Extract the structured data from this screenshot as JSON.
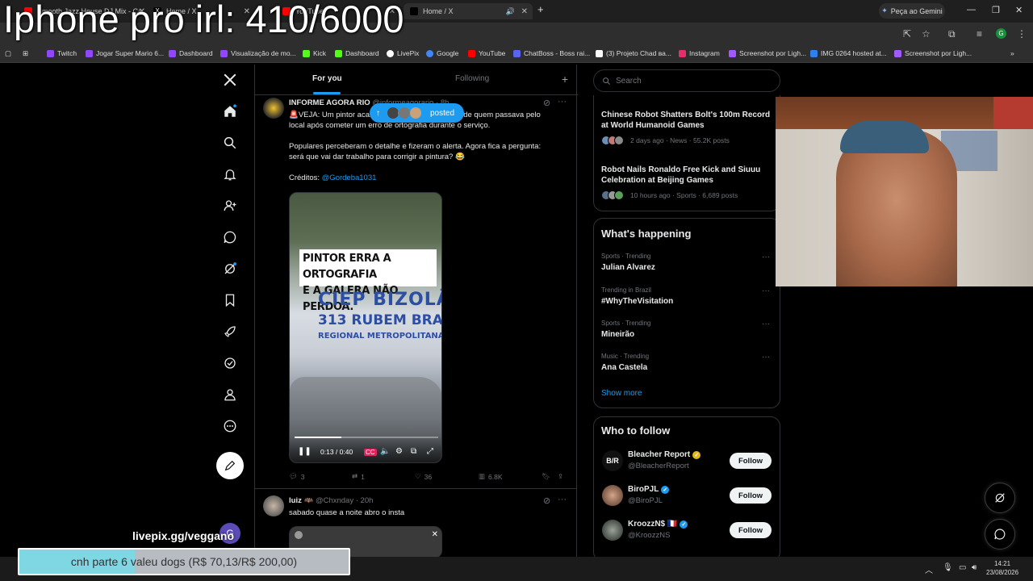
{
  "overlay": {
    "title": "Iphone pro irl: 410/6000",
    "livepix": "livepix.gg/veggano"
  },
  "browser": {
    "tabs": [
      {
        "label": "Smooth Jazz House DJ Mix - Ca",
        "color": "#ff0000"
      },
      {
        "label": "Home / X",
        "color": "#ffffff"
      },
      {
        "label": "YouTube",
        "color": "#ff0000"
      },
      {
        "label": "Home / X",
        "color": "#ffffff"
      }
    ],
    "gemini_label": "Peça ao Gemini",
    "address": "x.com/home",
    "bookmarks": [
      {
        "label": "Twitch",
        "color": "#9146ff"
      },
      {
        "label": "Jogar Super Mario 6...",
        "color": "#9146ff"
      },
      {
        "label": "Dashboard",
        "color": "#9146ff"
      },
      {
        "label": "Visualização de mo...",
        "color": "#9146ff"
      },
      {
        "label": "Kick",
        "color": "#53fc18"
      },
      {
        "label": "Dashboard",
        "color": "#53fc18"
      },
      {
        "label": "LivePix",
        "color": "#ffffff"
      },
      {
        "label": "Google",
        "color": "#4285f4"
      },
      {
        "label": "YouTube",
        "color": "#ff0000"
      },
      {
        "label": "ChatBoss - Boss rai...",
        "color": "#5865f2"
      },
      {
        "label": "(3) Projeto Chad ва...",
        "color": "#ffffff"
      },
      {
        "label": "Instagram",
        "color": "#e1306c"
      },
      {
        "label": "Screenshot por Ligh...",
        "color": "#a259ff"
      },
      {
        "label": "IMG 0264 hosted at...",
        "color": "#2f80ed"
      },
      {
        "label": "Screenshot por Ligh...",
        "color": "#a259ff"
      }
    ]
  },
  "timeline": {
    "tabs": [
      "For you",
      "Following"
    ],
    "active_tab": "For you",
    "posted_pill": "posted",
    "tweet1": {
      "name": "INFORME AGORA RIO",
      "handle": "@informeagorario · 8h",
      "text_line1": "🚨VEJA: Um pintor acabou virando alvo de piadas de quem passava pelo",
      "text_line2": "local após cometer um erro de ortografia durante o serviço.",
      "text_para2_line1": "Populares perceberam o detalhe e fizeram o alerta. Agora fica a pergunta:",
      "text_para2_line2": "será que vai dar trabalho para corrigir a pintura? 😂",
      "credits_label": "Créditos:",
      "credits_handle": "@Gordeba1031",
      "video": {
        "caption_line1": "PINTOR ERRA A ORTOGRAFIA",
        "caption_line2": "E A GALERA NÃO PERDOA.",
        "wall_line1": "CIEP BIZOLÃO",
        "wall_line2": "313 RUBEM BRAG",
        "wall_line3": "REGIONAL METROPOLITANA",
        "time": "0:13 / 0:40",
        "progress": 0.325
      },
      "replies": "3",
      "reposts": "1",
      "likes": "36",
      "views": "6.8K"
    },
    "tweet2": {
      "name": "luiz 🦇",
      "handle": "@Chxnday · 20h",
      "text": "sabado quase a noite abro o insta"
    }
  },
  "sidebar": {
    "search_placeholder": "Search",
    "news": [
      {
        "title": "Chinese Robot Shatters Bolt's 100m Record at World Humanoid Games",
        "meta": "2 days ago · News · 55.2K posts"
      },
      {
        "title": "Robot Nails Ronaldo Free Kick and Siuuu Celebration at Beijing Games",
        "meta": "10 hours ago · Sports · 6,689 posts"
      }
    ],
    "whats_happening": {
      "title": "What's happening",
      "trends": [
        {
          "context": "Sports · Trending",
          "name": "Julian Alvarez"
        },
        {
          "context": "Trending in Brazil",
          "name": "#WhyTheVisitation"
        },
        {
          "context": "Sports · Trending",
          "name": "Mineirão"
        },
        {
          "context": "Music · Trending",
          "name": "Ana Castela"
        }
      ],
      "show_more": "Show more"
    },
    "who_to_follow": {
      "title": "Who to follow",
      "users": [
        {
          "name": "Bleacher Report",
          "handle": "@BleacherReport",
          "badge_color": "#e2b719",
          "avatar_text": "B/R"
        },
        {
          "name": "BiroPJL",
          "handle": "@BiroPJL",
          "badge_color": "#1d9bf0",
          "avatar_text": ""
        },
        {
          "name": "KroozzN$ 🇫🇷",
          "handle": "@KroozzNS",
          "badge_color": "#1d9bf0",
          "avatar_text": ""
        }
      ],
      "follow_label": "Follow"
    }
  },
  "donation": {
    "text": "cnh parte 6 valeu dogs (R$ 70,13/R$ 200,00)",
    "progress": 0.35065
  },
  "taskbar": {
    "time": "14:21",
    "date": "23/08/2026"
  }
}
